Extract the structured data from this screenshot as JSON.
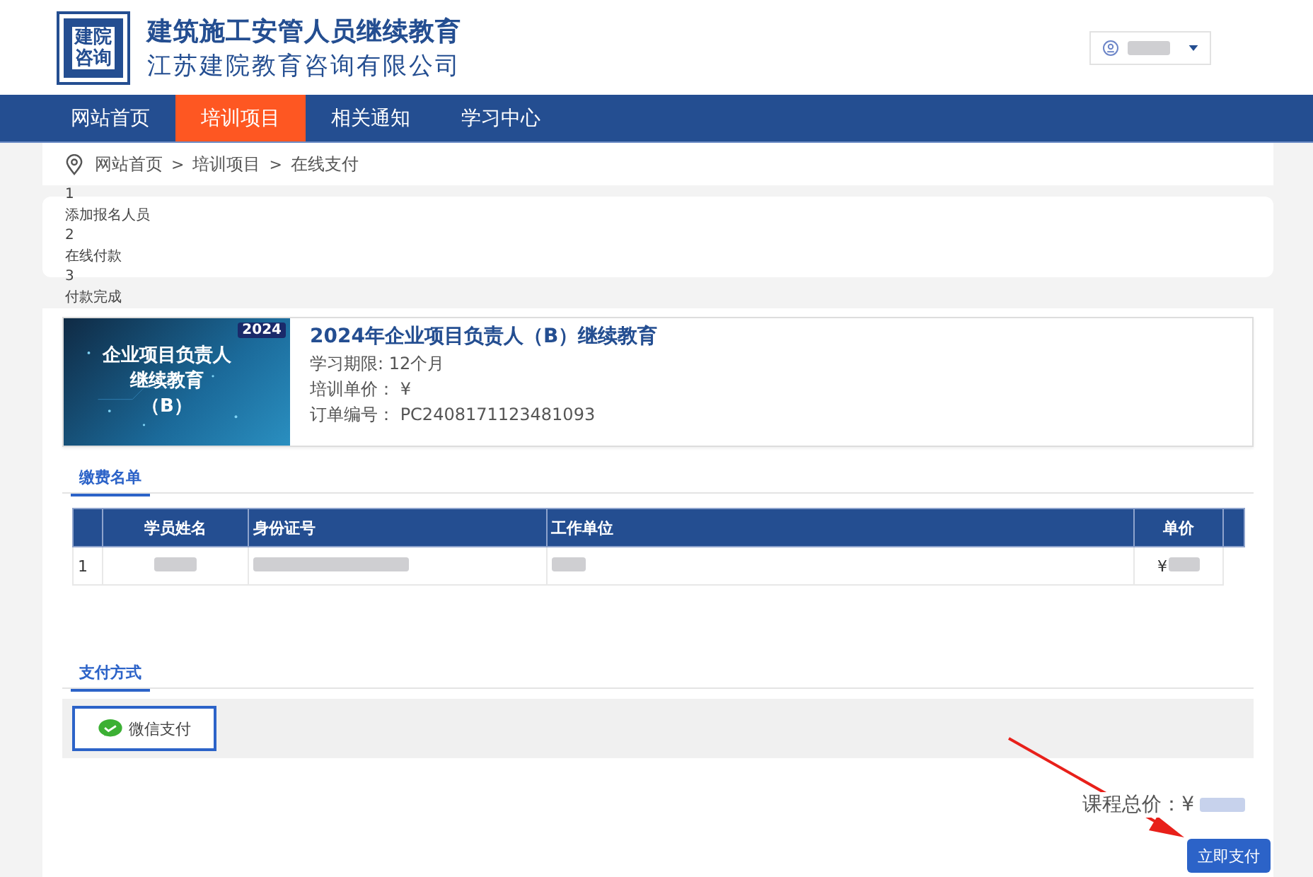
{
  "header": {
    "logo_lines": [
      "建院",
      "咨询"
    ],
    "title": "建筑施工安管人员继续教育",
    "subtitle": "江苏建院教育咨询有限公司"
  },
  "nav": [
    {
      "label": "网站首页",
      "selected": false
    },
    {
      "label": "培训项目",
      "selected": true
    },
    {
      "label": "相关通知",
      "selected": false
    },
    {
      "label": "学习中心",
      "selected": false
    }
  ],
  "breadcrumb": {
    "items": [
      "网站首页",
      "培训项目",
      "在线支付"
    ],
    "separator": ">"
  },
  "steps": [
    {
      "number": "1",
      "label": "添加报名人员"
    },
    {
      "number": "2",
      "label": "在线付款"
    },
    {
      "number": "3",
      "label": "付款完成"
    }
  ],
  "course": {
    "image_year": "2024",
    "image_lines": [
      "企业项目负责人",
      "继续教育",
      "（B）"
    ],
    "title": "2024年企业项目负责人（B）继续教育",
    "fields": [
      {
        "label": "学习期限:",
        "value": "12个月"
      },
      {
        "label": "培训单价：",
        "value": "¥"
      },
      {
        "label": "订单编号：",
        "value": "PC2408171123481093"
      }
    ]
  },
  "roster": {
    "tab": "缴费名单",
    "columns": [
      "学员姓名",
      "身份证号",
      "工作单位",
      "单价"
    ],
    "rows": [
      {
        "index": "1",
        "price": "¥"
      }
    ]
  },
  "payment": {
    "tab": "支付方式",
    "methods": [
      {
        "label": "微信支付",
        "selected": true
      }
    ]
  },
  "total": {
    "label": "课程总价：",
    "value": "¥"
  },
  "pay_button": "立即支付"
}
